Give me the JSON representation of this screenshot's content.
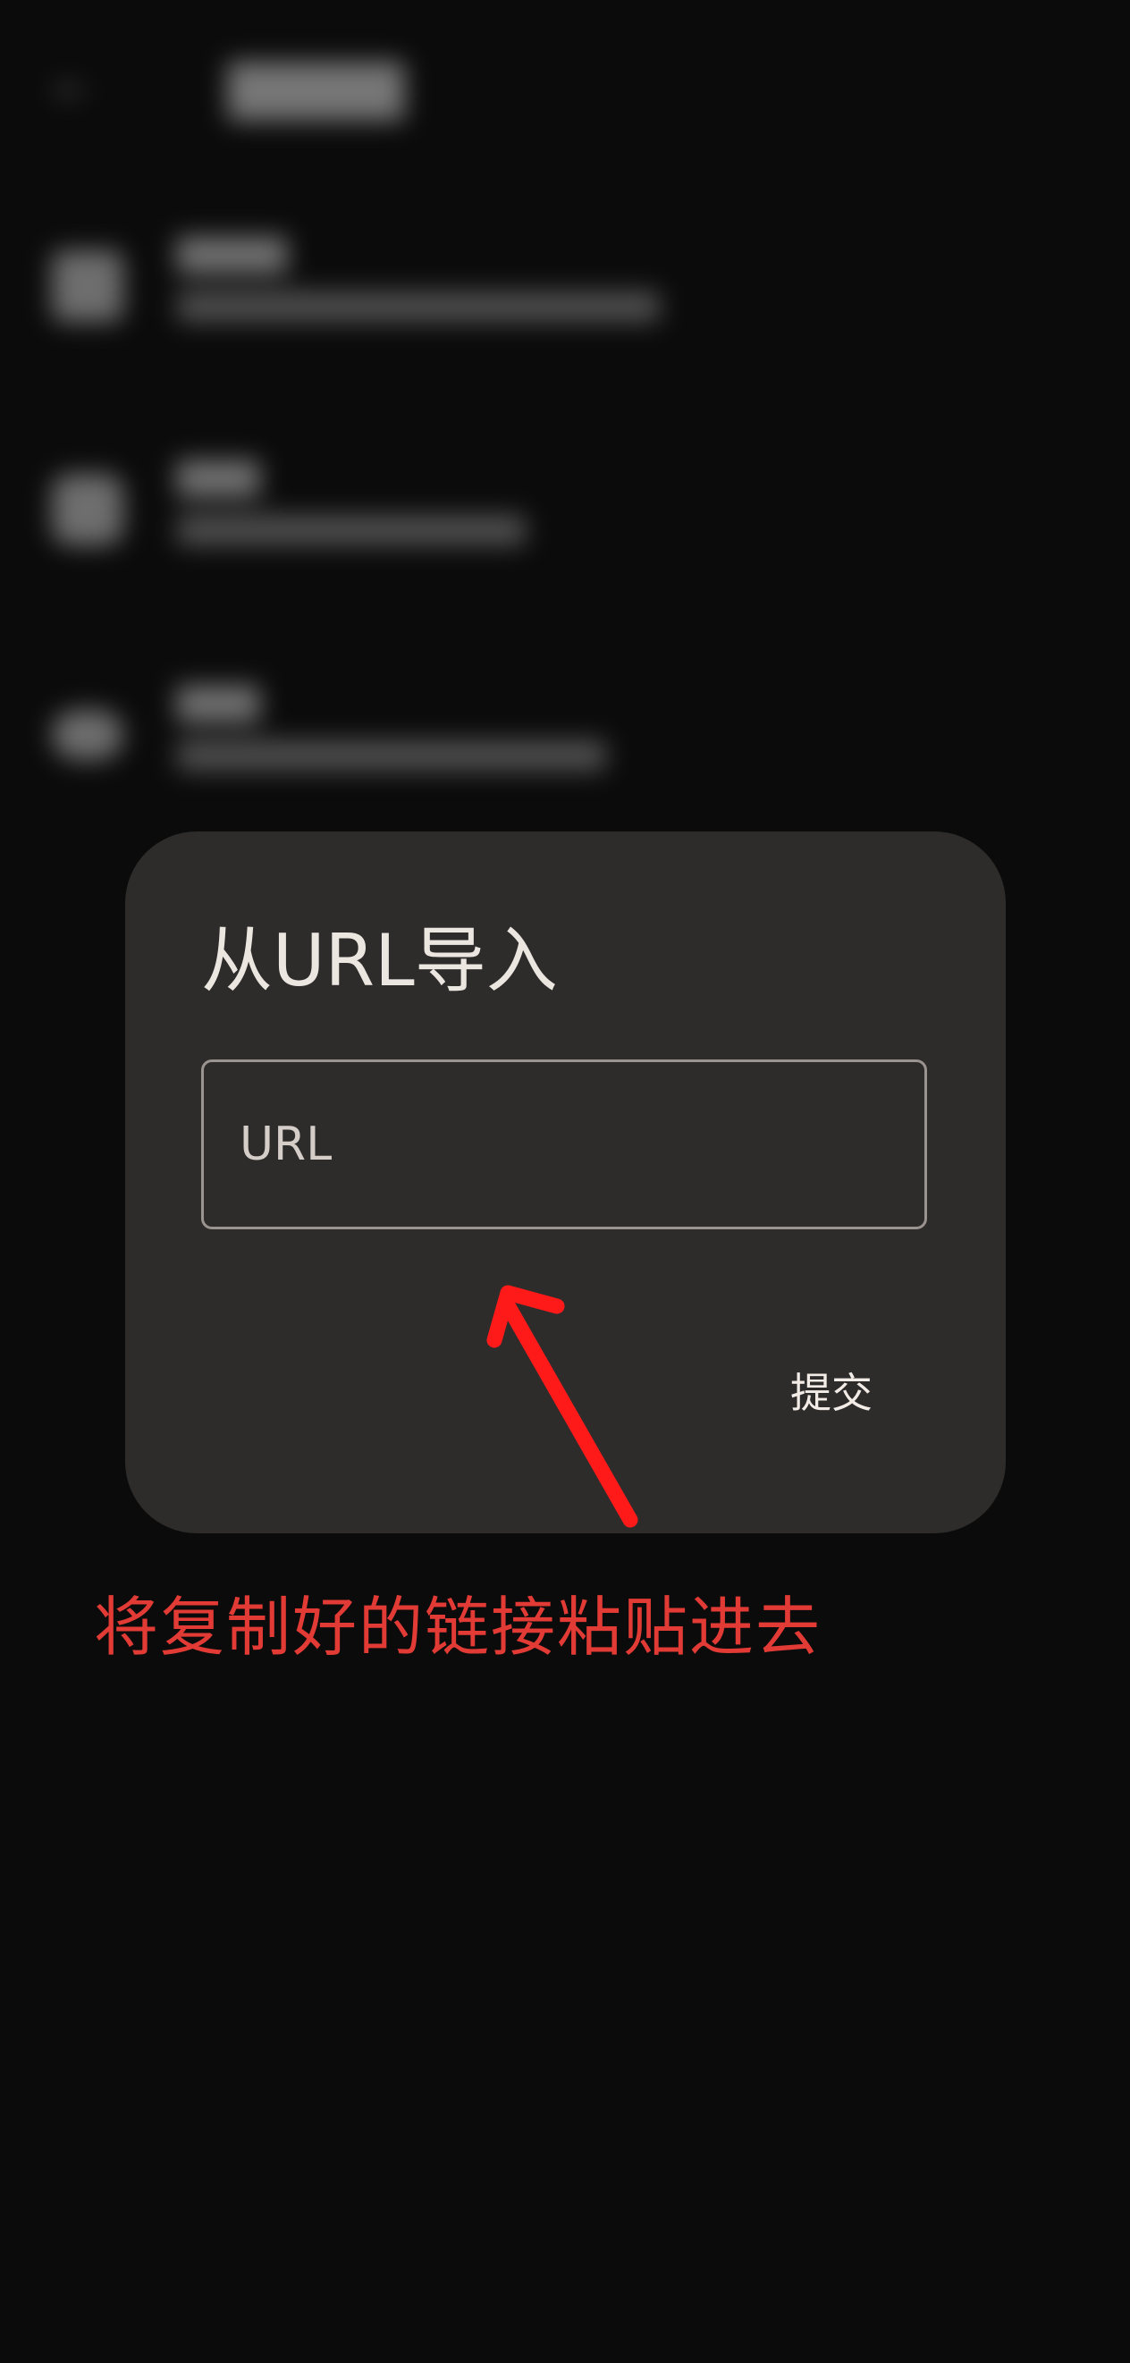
{
  "dialog": {
    "title": "从URL导入",
    "url_placeholder": "URL",
    "url_value": "",
    "submit_label": "提交"
  },
  "annotation": {
    "instruction": "将复制好的链接粘贴进去",
    "color": "#e23b36"
  },
  "colors": {
    "background": "#0b0b0b",
    "dialog_background": "#2d2c2b",
    "annotation_red": "#ff1a1a"
  }
}
